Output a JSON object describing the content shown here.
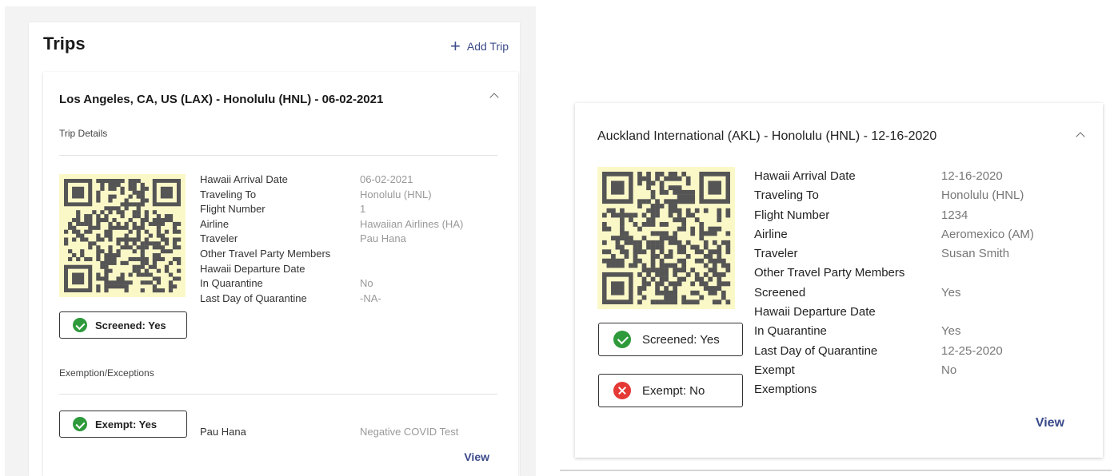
{
  "header_fragment": "",
  "left": {
    "title": "Trips",
    "add_trip": "Add Trip",
    "trip": {
      "route": "Los Angeles, CA, US (LAX) - Honolulu (HNL) - 06-02-2021",
      "section_details": "Trip Details",
      "details": [
        {
          "label": "Hawaii Arrival Date",
          "value": "06-02-2021"
        },
        {
          "label": "Traveling To",
          "value": "Honolulu (HNL)"
        },
        {
          "label": "Flight Number",
          "value": "1"
        },
        {
          "label": "Airline",
          "value": "Hawaiian Airlines (HA)"
        },
        {
          "label": "Traveler",
          "value": "Pau Hana"
        },
        {
          "label": "Other Travel Party Members",
          "value": ""
        },
        {
          "label": "Hawaii Departure Date",
          "value": ""
        },
        {
          "label": "In Quarantine",
          "value": "No"
        },
        {
          "label": "Last Day of Quarantine",
          "value": "-NA-"
        }
      ],
      "screened_badge": "Screened: Yes",
      "section_exemptions": "Exemption/Exceptions",
      "exempt_badge": "Exempt: Yes",
      "exempt_name": "Pau Hana",
      "exempt_reason": "Negative COVID Test",
      "view": "View"
    }
  },
  "right": {
    "route": "Auckland International (AKL) - Honolulu (HNL) - 12-16-2020",
    "details": [
      {
        "label": "Hawaii Arrival Date",
        "value": "12-16-2020"
      },
      {
        "label": "Traveling To",
        "value": "Honolulu (HNL)"
      },
      {
        "label": "Flight Number",
        "value": "1234"
      },
      {
        "label": "Airline",
        "value": "Aeromexico (AM)"
      },
      {
        "label": "Traveler",
        "value": "Susan Smith"
      },
      {
        "label": "Other Travel Party Members",
        "value": ""
      },
      {
        "label": "Screened",
        "value": "Yes"
      },
      {
        "label": "Hawaii Departure Date",
        "value": ""
      },
      {
        "label": "In Quarantine",
        "value": "Yes"
      },
      {
        "label": "Last Day of Quarantine",
        "value": "12-25-2020"
      },
      {
        "label": "Exempt",
        "value": "No"
      },
      {
        "label": "Exemptions",
        "value": ""
      }
    ],
    "screened_badge": "Screened: Yes",
    "exempt_badge": "Exempt: No",
    "view": "View"
  },
  "colors": {
    "accent": "#3b4a8a",
    "qr_background": "#fbf8c8",
    "status_ok": "#2e9a3b",
    "status_no": "#e53935"
  },
  "icons": [
    "plus-icon",
    "chevron-up-icon",
    "qr-code-icon",
    "check-circle-icon",
    "x-circle-icon"
  ]
}
